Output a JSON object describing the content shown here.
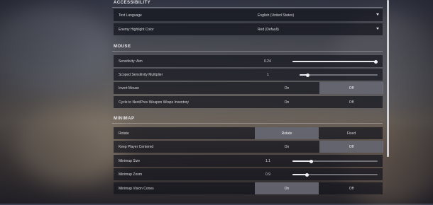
{
  "sections": {
    "accessibility": {
      "title": "ACCESSIBILITY"
    },
    "mouse": {
      "title": "MOUSE"
    },
    "minimap": {
      "title": "MINIMAP"
    }
  },
  "accessibility": {
    "text_language": {
      "label": "Text Language",
      "value": "English (United States)"
    },
    "enemy_highlight_color": {
      "label": "Enemy Highlight Color",
      "value": "Red (Default)"
    }
  },
  "mouse": {
    "sensitivity_aim": {
      "label": "Sensitivity: Aim",
      "value": "0.24",
      "fraction": 0.98
    },
    "scoped_sensitivity": {
      "label": "Scoped Sensitivity Multiplier",
      "value": "1",
      "fraction": 0.1
    },
    "invert_mouse": {
      "label": "Invert Mouse",
      "on": "On",
      "off": "Off",
      "selected": "off"
    },
    "cycle_weapon": {
      "label": "Cycle to Next/Prev Weapon Wraps Inventory",
      "on": "On",
      "off": "Off",
      "selected": "none"
    }
  },
  "minimap": {
    "rotate": {
      "label": "Rotate",
      "opt1": "Rotate",
      "opt2": "Fixed",
      "selected": "opt1"
    },
    "keep_player_centered": {
      "label": "Keep Player Centered",
      "on": "On",
      "off": "Off",
      "selected": "off"
    },
    "minimap_size": {
      "label": "Minimap Size",
      "value": "1.1",
      "fraction": 0.22
    },
    "minimap_zoom": {
      "label": "Minimap Zoom",
      "value": "0.9",
      "fraction": 0.17
    },
    "minimap_vision_cones": {
      "label": "Minimap Vision Cones",
      "on": "On",
      "off": "Off",
      "selected": "on"
    }
  },
  "colors": {
    "row_bg": "#12141c",
    "active_toggle": "#787a84",
    "text": "#d5d6db"
  }
}
